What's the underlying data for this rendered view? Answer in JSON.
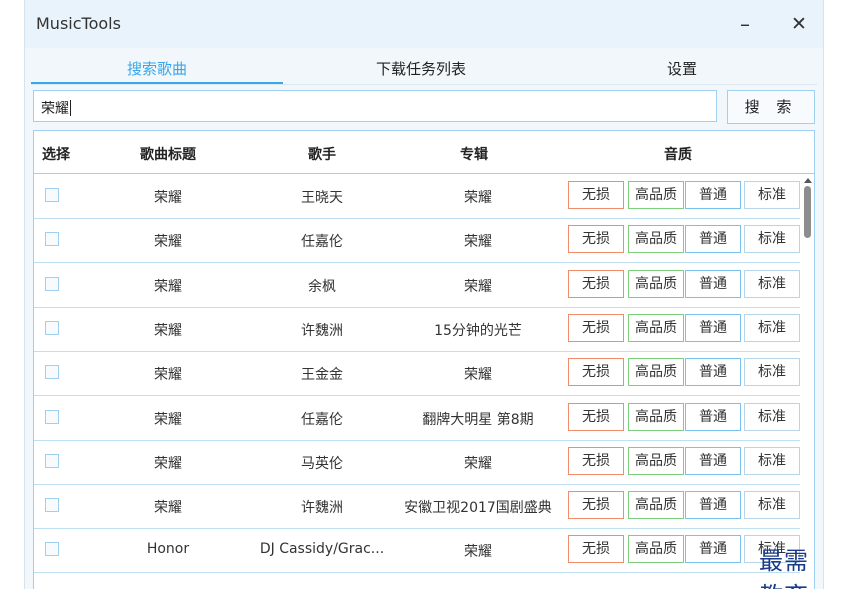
{
  "window": {
    "title": "MusicTools",
    "minimize_glyph": "–",
    "close_glyph": "✕"
  },
  "tabs": [
    {
      "label": "搜索歌曲",
      "active": true
    },
    {
      "label": "下载任务列表"
    },
    {
      "label": "设置"
    }
  ],
  "search": {
    "value": "荣耀",
    "button_label": "搜 索"
  },
  "table": {
    "headers": [
      "选择",
      "歌曲标题",
      "歌手",
      "专辑",
      "音质"
    ],
    "rows": [
      {
        "title": "荣耀",
        "artist": "王晓天",
        "album": "荣耀"
      },
      {
        "title": "荣耀",
        "artist": "任嘉伦",
        "album": "荣耀"
      },
      {
        "title": "荣耀",
        "artist": "余枫",
        "album": "荣耀"
      },
      {
        "title": "荣耀",
        "artist": "许魏洲",
        "album": "15分钟的光芒"
      },
      {
        "title": "荣耀",
        "artist": "王金金",
        "album": "荣耀"
      },
      {
        "title": "荣耀",
        "artist": "任嘉伦",
        "album": "翻牌大明星 第8期"
      },
      {
        "title": "荣耀",
        "artist": "马英伦",
        "album": "荣耀"
      },
      {
        "title": "荣耀",
        "artist": "许魏洲",
        "album": "安徽卫视2017国剧盛典"
      },
      {
        "title": "Honor",
        "artist": "DJ Cassidy/Grac...",
        "album": "荣耀"
      }
    ],
    "quality_labels": [
      "无损",
      "高品质",
      "普通",
      "标准"
    ]
  },
  "colors": {
    "accent": "#39a6ea",
    "lossless": "#f08d6b",
    "high": "#7ccf7c",
    "normal": "#78c1ee"
  },
  "watermark": "最需教育"
}
